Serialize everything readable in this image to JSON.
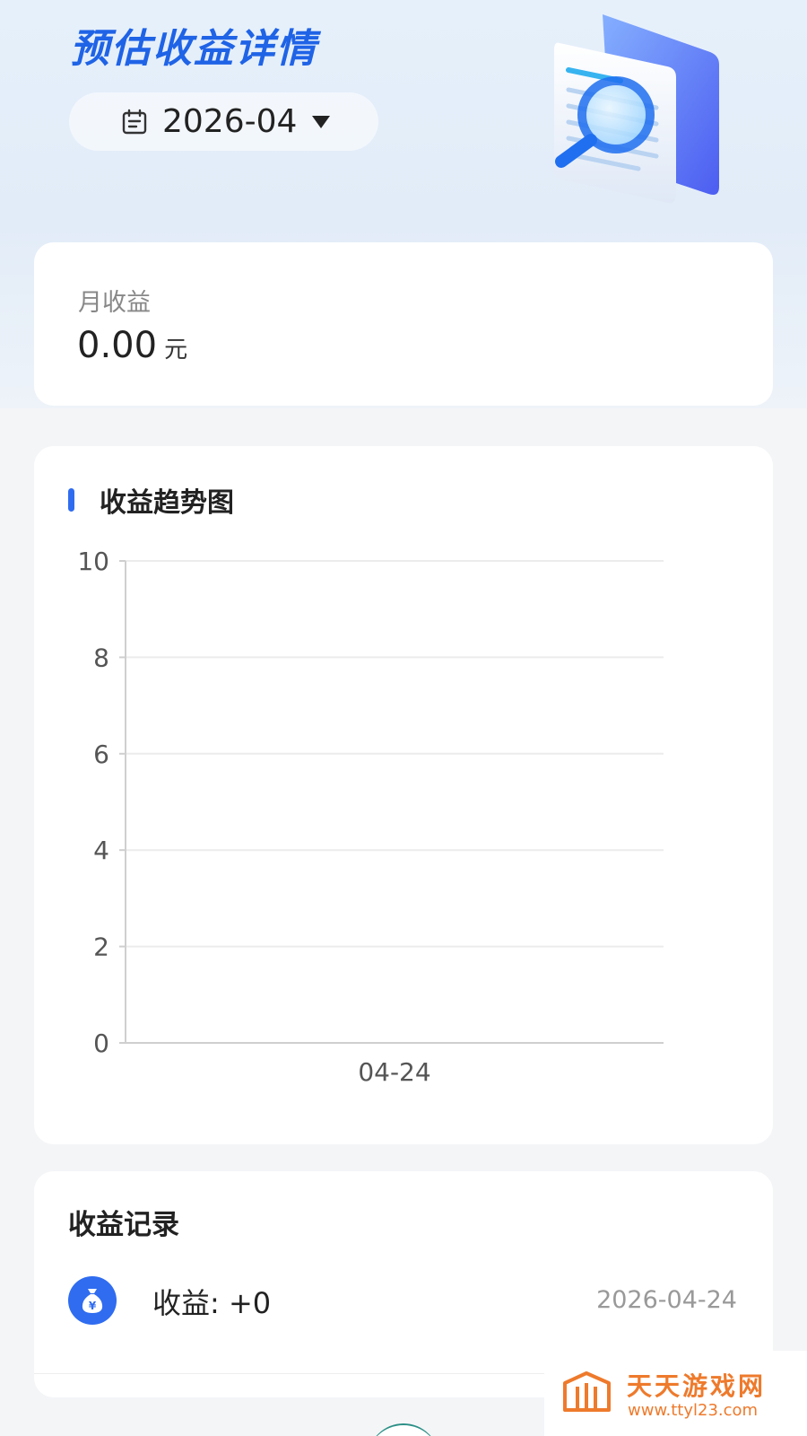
{
  "header": {
    "title": "预估收益详情",
    "month_picker": {
      "value": "2026-04",
      "icon": "calendar-icon",
      "dropdown_icon": "caret-down-icon"
    },
    "illustration": "document-search-illustration"
  },
  "monthly": {
    "label": "月收益",
    "value": "0.00",
    "unit": "元"
  },
  "chart_section": {
    "title": "收益趋势图"
  },
  "chart_data": {
    "type": "line",
    "title": "收益趋势图",
    "categories": [
      "04-24"
    ],
    "series": [
      {
        "values": [
          0
        ]
      }
    ],
    "yticks": [
      "0",
      "2",
      "4",
      "6",
      "8",
      "10"
    ],
    "ylim": [
      0,
      10
    ],
    "grid": true,
    "xlabel": "",
    "ylabel": ""
  },
  "records": {
    "title": "收益记录",
    "items": [
      {
        "text": "收益: +0",
        "date": "2026-04-24",
        "icon": "money-bag-icon"
      }
    ]
  },
  "watermark": {
    "name": "天天游戏网",
    "url": "www.ttyl23.com"
  },
  "colors": {
    "accent": "#2f6cf0",
    "title_blue": "#1f63e6",
    "watermark_orange": "#ee7a2c"
  }
}
